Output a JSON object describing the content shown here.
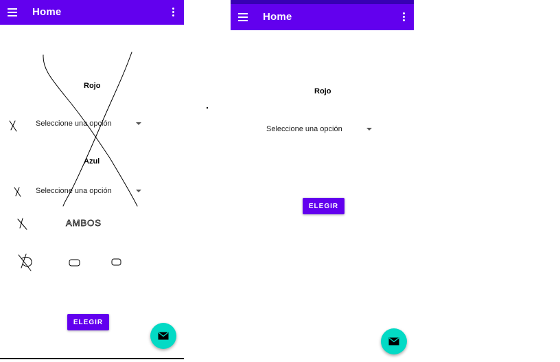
{
  "colors": {
    "primary": "#6200ee",
    "primary_dark": "#3700b3",
    "fab": "#03dac5"
  },
  "left": {
    "appbar": {
      "title": "Home",
      "menu_icon": "hamburger-icon",
      "more_icon": "more-vert-icon"
    },
    "label_red": "Rojo",
    "select_red": "Seleccione una opción",
    "label_blue": "Azul",
    "select_blue": "Seleccione una opción",
    "handwritten_note": "AMBOS",
    "button": "ELEGIR",
    "fab_icon": "mail-icon"
  },
  "right": {
    "appbar": {
      "title": "Home",
      "menu_icon": "hamburger-icon",
      "more_icon": "more-vert-icon"
    },
    "label_red": "Rojo",
    "select_red": "Seleccione una opción",
    "button": "ELEGIR",
    "fab_icon": "mail-icon"
  }
}
